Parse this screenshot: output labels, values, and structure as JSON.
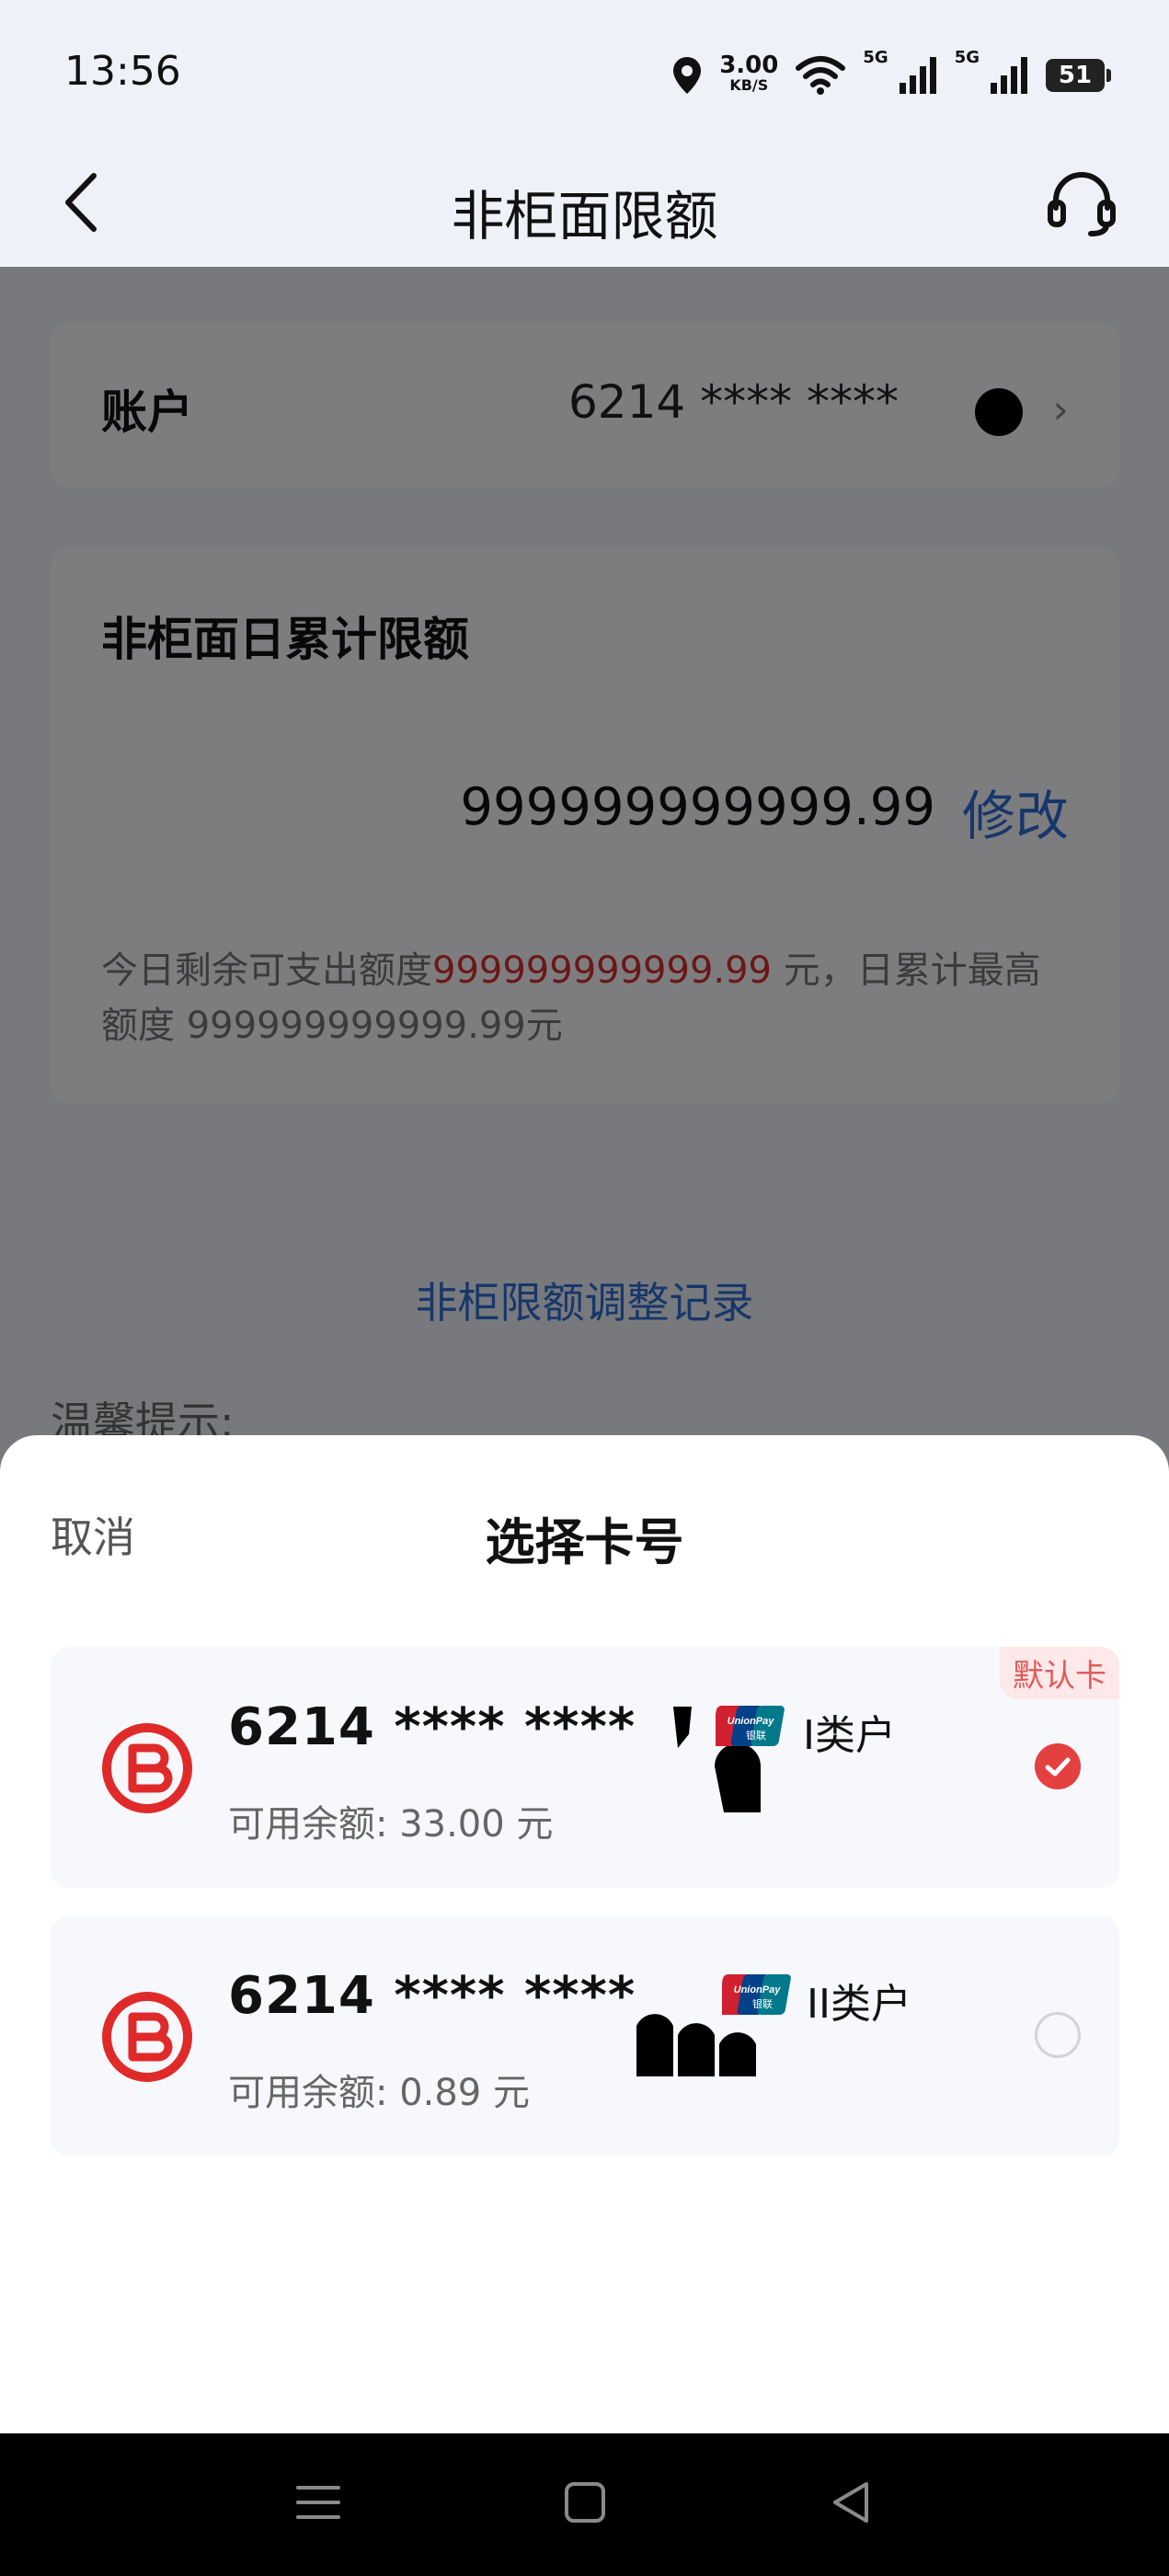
{
  "status_bar": {
    "time": "13:56",
    "speed_value": "3.00",
    "speed_unit": "KB/S",
    "signal_label_1": "5G",
    "signal_label_2": "5G",
    "battery": "51",
    "icons": [
      "location-icon",
      "wifi-icon",
      "signal-icon",
      "signal-icon",
      "battery-icon"
    ]
  },
  "nav": {
    "title": "非柜面限额",
    "back_icon": "chevron-left-icon",
    "service_icon": "headset-icon"
  },
  "account": {
    "label": "账户",
    "number": "6214 **** ****",
    "chevron": "›"
  },
  "limit": {
    "title": "非柜面日累计限额",
    "amount": "999999999999.99",
    "modify_label": "修改",
    "note_prefix": "今日剩余可支出额度",
    "note_remaining": "999999999999.99",
    "note_middle": " 元，日累计最高额度 ",
    "note_max": "999999999999.99",
    "note_suffix": "元"
  },
  "record_link": "非柜限额调整记录",
  "tips_heading": "温馨提示:",
  "sheet": {
    "cancel_label": "取消",
    "title": "选择卡号",
    "cards": [
      {
        "number": "6214 **** ****",
        "type": "I类户",
        "balance": "可用余额: 33.00 元",
        "badge": "默认卡",
        "selected": true
      },
      {
        "number": "6214 **** ****",
        "type": "II类户",
        "balance": "可用余额: 0.89 元",
        "selected": false
      }
    ],
    "unionpay_text": "UnionPay",
    "unionpay_cn": "银联"
  },
  "colors": {
    "accent_blue": "#2f6fd6",
    "brand_red": "#e02a2a",
    "highlight_red": "#d62e2e"
  },
  "system_nav": {
    "icons": [
      "menu-icon",
      "home-icon",
      "back-icon"
    ]
  }
}
